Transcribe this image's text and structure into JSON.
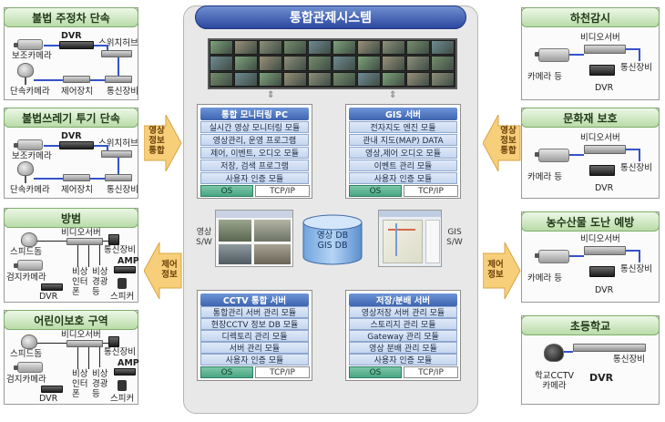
{
  "title": "통합관제시스템",
  "center": {
    "monitoring": {
      "title": "통합 모니터링 PC",
      "items": [
        "실시간 영상 모니터링 모듈",
        "영상관리, 운영 프로그램",
        "제어, 이벤트, 오디오 모듈",
        "저장, 검색 프로그램",
        "사용자 인증 모듈"
      ],
      "os": "OS",
      "tcp": "TCP/IP"
    },
    "gis": {
      "title": "GIS 서버",
      "items": [
        "전자지도 엔진 모듈",
        "관내 지도(MAP) DATA",
        "영상,제어 오디오 모듈",
        "이벤트 관리 모듈",
        "사용자 인증 모듈"
      ],
      "os": "OS",
      "tcp": "TCP/IP"
    },
    "cctv": {
      "title": "CCTV 통합 서버",
      "items": [
        "통합관리 서버 관리 모듈",
        "현장CCTV 정보 DB 모듈",
        "디렉토리 관리 모듈",
        "서버 관리 모듈",
        "사용자 인증 모듈"
      ],
      "os": "OS",
      "tcp": "TCP/IP"
    },
    "storage": {
      "title": "저장/분배 서버",
      "items": [
        "영상저장 서버 관리 모듈",
        "스토리지 관리 모듈",
        "Gateway 관리 모듈",
        "영상 분배 관리 모듈",
        "사용자 인증 모듈"
      ],
      "os": "OS",
      "tcp": "TCP/IP"
    },
    "db": {
      "line1": "영상 DB",
      "line2": "GIS DB"
    },
    "video_sw": "영상\nS/W",
    "gis_sw": "GIS\nS/W"
  },
  "arrows": {
    "left_in": "영상\n정보\n통합",
    "left_out": "제어\n정보",
    "right_in": "영상\n정보\n통합",
    "right_out": "제어\n정보"
  },
  "left_sites": [
    {
      "title": "불법 주정차 단속",
      "dvr": "DVR",
      "cam": "보조카메라",
      "switch": "스위치허브",
      "dome": "단속카메라",
      "ctrl": "제어장치",
      "comm": "통신장비"
    },
    {
      "title": "불법쓰레기 투기 단속",
      "dvr": "DVR",
      "cam": "보조카메라",
      "switch": "스위치허브",
      "dome": "단속카메라",
      "ctrl": "제어장치",
      "comm": "통신장비"
    },
    {
      "title": "방범",
      "server": "비디오서버",
      "speed": "스피드돔",
      "comm": "통신장비",
      "amp": "AMP",
      "cam": "검지카메라",
      "intercom": "비상\n인터\n폰",
      "alarm": "비상\n경광\n등",
      "dvr": "DVR",
      "spk": "스피커"
    },
    {
      "title": "어린이보호 구역",
      "server": "비디오서버",
      "speed": "스피드돔",
      "comm": "통신장비",
      "amp": "AMP",
      "cam": "검지카메라",
      "intercom": "비상\n인터\n폰",
      "alarm": "비상\n경광\n등",
      "dvr": "DVR",
      "spk": "스피커"
    }
  ],
  "right_sites": [
    {
      "title": "하천감시",
      "server": "비디오서버",
      "cam": "카메라 등",
      "comm": "통신장비",
      "dvr": "DVR"
    },
    {
      "title": "문화재 보호",
      "server": "비디오서버",
      "cam": "카메라 등",
      "comm": "통신장비",
      "dvr": "DVR"
    },
    {
      "title": "농수산물 도난 예방",
      "server": "비디오서버",
      "cam": "카메라 등",
      "comm": "통신장비",
      "dvr": "DVR"
    },
    {
      "title": "초등학교",
      "cam": "학교CCTV\n카메라",
      "dvr": "DVR",
      "comm": "통신장비"
    }
  ],
  "colors": {
    "accent": "#2b48a0",
    "site_title": "#b9dca8",
    "arrow": "#f7cf7a",
    "os": "#48a582"
  }
}
